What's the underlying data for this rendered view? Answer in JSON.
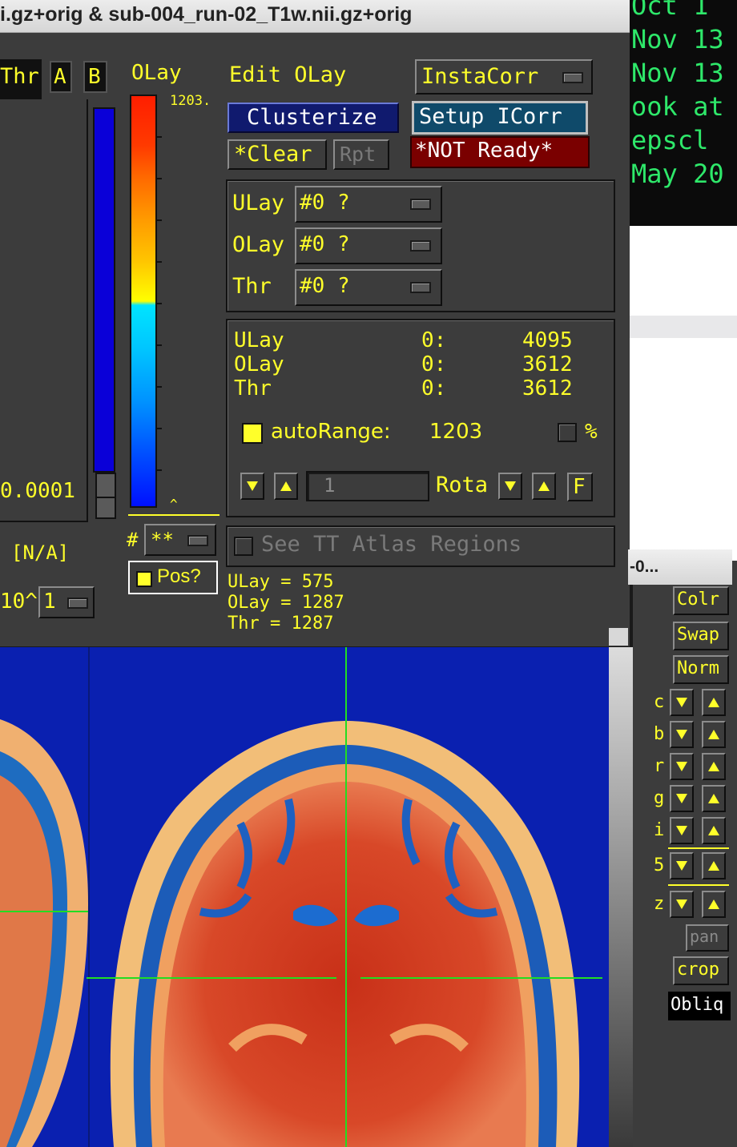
{
  "window": {
    "title": "i.gz+orig & sub-004_run-02_T1w.nii.gz+orig"
  },
  "terminal": {
    "lines": [
      "Oct  1",
      "Nov 13",
      "Nov 13",
      "ook at",
      "epscl ",
      "May 20"
    ]
  },
  "left_panel": {
    "thr_label": "Thr",
    "a_label": "A",
    "b_label": "B",
    "thr_value": "0.0001",
    "na_label": "[N/A]",
    "exp_label": "10^",
    "exp_value": "1"
  },
  "olay_column": {
    "label": "OLay",
    "scale_top": "1203.",
    "scale_caret": "^",
    "hash_label": "#",
    "hash_value": "**",
    "pos_label": "Pos?"
  },
  "edit_section": {
    "title": "Edit OLay",
    "instacorr_label": "InstaCorr",
    "clusterize_label": "Clusterize",
    "setup_icorr_label": "Setup ICorr",
    "clear_label": "*Clear",
    "rpt_label": "Rpt",
    "not_ready_label": "*NOT Ready*"
  },
  "subbrick": {
    "rows": [
      {
        "label": "ULay",
        "value": "#0 ?"
      },
      {
        "label": "OLay",
        "value": "#0 ?"
      },
      {
        "label": "Thr",
        "value": "#0 ?"
      }
    ]
  },
  "stats": {
    "rows": [
      {
        "label": "ULay",
        "index": "0:",
        "value": "4095"
      },
      {
        "label": "OLay",
        "index": "0:",
        "value": "3612"
      },
      {
        "label": "Thr",
        "index": "0:",
        "value": "3612"
      }
    ],
    "autorange_label": "autoRange:",
    "autorange_value": "1203",
    "percent_label": "%",
    "rota_value": "1",
    "rota_label": "Rota",
    "f_label": "F"
  },
  "atlas": {
    "label": "See TT Atlas Regions"
  },
  "readout": {
    "ulay": "ULay = 575",
    "olay": "OLay = 1287",
    "thr": "Thr  = 1287"
  },
  "side_panel": {
    "title": "-0...",
    "colr_label": "Colr",
    "swap_label": "Swap",
    "norm_label": "Norm",
    "rows": [
      "c",
      "b",
      "r",
      "g",
      "i"
    ],
    "s_label": "5",
    "z_label": "z",
    "pan_label": "pan",
    "crop_label": "crop",
    "obliq_label": "Obliq"
  },
  "colors": {
    "panel_bg": "#3c3c3c",
    "text_yellow": "#ffff2a",
    "terminal_green": "#2ee86a",
    "clusterize_bg": "#101a6e",
    "setup_icorr_bg": "#0f4a6a",
    "not_ready_bg": "#7a0000",
    "crosshair": "#22dd22"
  }
}
